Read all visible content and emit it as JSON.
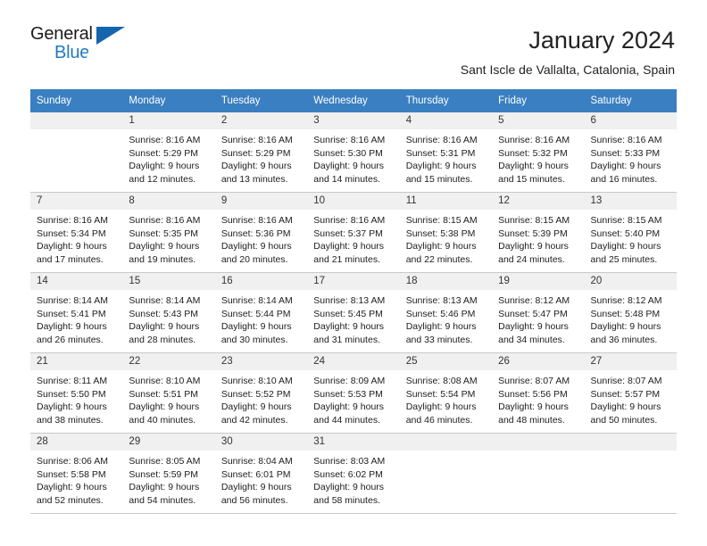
{
  "brand": {
    "name_top": "General",
    "name_bottom": "Blue",
    "accent_color": "#1f7ac4",
    "triangle_color": "#1565ac"
  },
  "header": {
    "title": "January 2024",
    "subtitle": "Sant Iscle de Vallalta, Catalonia, Spain"
  },
  "calendar": {
    "header_bg": "#3a7fc1",
    "daynum_bg": "#f0f0f0",
    "grid_line": "#c8c8c8",
    "weekdays": [
      "Sunday",
      "Monday",
      "Tuesday",
      "Wednesday",
      "Thursday",
      "Friday",
      "Saturday"
    ],
    "weeks": [
      [
        {
          "day": "",
          "sunrise": "",
          "sunset": "",
          "daylight_1": "",
          "daylight_2": ""
        },
        {
          "day": "1",
          "sunrise": "Sunrise: 8:16 AM",
          "sunset": "Sunset: 5:29 PM",
          "daylight_1": "Daylight: 9 hours",
          "daylight_2": "and 12 minutes."
        },
        {
          "day": "2",
          "sunrise": "Sunrise: 8:16 AM",
          "sunset": "Sunset: 5:29 PM",
          "daylight_1": "Daylight: 9 hours",
          "daylight_2": "and 13 minutes."
        },
        {
          "day": "3",
          "sunrise": "Sunrise: 8:16 AM",
          "sunset": "Sunset: 5:30 PM",
          "daylight_1": "Daylight: 9 hours",
          "daylight_2": "and 14 minutes."
        },
        {
          "day": "4",
          "sunrise": "Sunrise: 8:16 AM",
          "sunset": "Sunset: 5:31 PM",
          "daylight_1": "Daylight: 9 hours",
          "daylight_2": "and 15 minutes."
        },
        {
          "day": "5",
          "sunrise": "Sunrise: 8:16 AM",
          "sunset": "Sunset: 5:32 PM",
          "daylight_1": "Daylight: 9 hours",
          "daylight_2": "and 15 minutes."
        },
        {
          "day": "6",
          "sunrise": "Sunrise: 8:16 AM",
          "sunset": "Sunset: 5:33 PM",
          "daylight_1": "Daylight: 9 hours",
          "daylight_2": "and 16 minutes."
        }
      ],
      [
        {
          "day": "7",
          "sunrise": "Sunrise: 8:16 AM",
          "sunset": "Sunset: 5:34 PM",
          "daylight_1": "Daylight: 9 hours",
          "daylight_2": "and 17 minutes."
        },
        {
          "day": "8",
          "sunrise": "Sunrise: 8:16 AM",
          "sunset": "Sunset: 5:35 PM",
          "daylight_1": "Daylight: 9 hours",
          "daylight_2": "and 19 minutes."
        },
        {
          "day": "9",
          "sunrise": "Sunrise: 8:16 AM",
          "sunset": "Sunset: 5:36 PM",
          "daylight_1": "Daylight: 9 hours",
          "daylight_2": "and 20 minutes."
        },
        {
          "day": "10",
          "sunrise": "Sunrise: 8:16 AM",
          "sunset": "Sunset: 5:37 PM",
          "daylight_1": "Daylight: 9 hours",
          "daylight_2": "and 21 minutes."
        },
        {
          "day": "11",
          "sunrise": "Sunrise: 8:15 AM",
          "sunset": "Sunset: 5:38 PM",
          "daylight_1": "Daylight: 9 hours",
          "daylight_2": "and 22 minutes."
        },
        {
          "day": "12",
          "sunrise": "Sunrise: 8:15 AM",
          "sunset": "Sunset: 5:39 PM",
          "daylight_1": "Daylight: 9 hours",
          "daylight_2": "and 24 minutes."
        },
        {
          "day": "13",
          "sunrise": "Sunrise: 8:15 AM",
          "sunset": "Sunset: 5:40 PM",
          "daylight_1": "Daylight: 9 hours",
          "daylight_2": "and 25 minutes."
        }
      ],
      [
        {
          "day": "14",
          "sunrise": "Sunrise: 8:14 AM",
          "sunset": "Sunset: 5:41 PM",
          "daylight_1": "Daylight: 9 hours",
          "daylight_2": "and 26 minutes."
        },
        {
          "day": "15",
          "sunrise": "Sunrise: 8:14 AM",
          "sunset": "Sunset: 5:43 PM",
          "daylight_1": "Daylight: 9 hours",
          "daylight_2": "and 28 minutes."
        },
        {
          "day": "16",
          "sunrise": "Sunrise: 8:14 AM",
          "sunset": "Sunset: 5:44 PM",
          "daylight_1": "Daylight: 9 hours",
          "daylight_2": "and 30 minutes."
        },
        {
          "day": "17",
          "sunrise": "Sunrise: 8:13 AM",
          "sunset": "Sunset: 5:45 PM",
          "daylight_1": "Daylight: 9 hours",
          "daylight_2": "and 31 minutes."
        },
        {
          "day": "18",
          "sunrise": "Sunrise: 8:13 AM",
          "sunset": "Sunset: 5:46 PM",
          "daylight_1": "Daylight: 9 hours",
          "daylight_2": "and 33 minutes."
        },
        {
          "day": "19",
          "sunrise": "Sunrise: 8:12 AM",
          "sunset": "Sunset: 5:47 PM",
          "daylight_1": "Daylight: 9 hours",
          "daylight_2": "and 34 minutes."
        },
        {
          "day": "20",
          "sunrise": "Sunrise: 8:12 AM",
          "sunset": "Sunset: 5:48 PM",
          "daylight_1": "Daylight: 9 hours",
          "daylight_2": "and 36 minutes."
        }
      ],
      [
        {
          "day": "21",
          "sunrise": "Sunrise: 8:11 AM",
          "sunset": "Sunset: 5:50 PM",
          "daylight_1": "Daylight: 9 hours",
          "daylight_2": "and 38 minutes."
        },
        {
          "day": "22",
          "sunrise": "Sunrise: 8:10 AM",
          "sunset": "Sunset: 5:51 PM",
          "daylight_1": "Daylight: 9 hours",
          "daylight_2": "and 40 minutes."
        },
        {
          "day": "23",
          "sunrise": "Sunrise: 8:10 AM",
          "sunset": "Sunset: 5:52 PM",
          "daylight_1": "Daylight: 9 hours",
          "daylight_2": "and 42 minutes."
        },
        {
          "day": "24",
          "sunrise": "Sunrise: 8:09 AM",
          "sunset": "Sunset: 5:53 PM",
          "daylight_1": "Daylight: 9 hours",
          "daylight_2": "and 44 minutes."
        },
        {
          "day": "25",
          "sunrise": "Sunrise: 8:08 AM",
          "sunset": "Sunset: 5:54 PM",
          "daylight_1": "Daylight: 9 hours",
          "daylight_2": "and 46 minutes."
        },
        {
          "day": "26",
          "sunrise": "Sunrise: 8:07 AM",
          "sunset": "Sunset: 5:56 PM",
          "daylight_1": "Daylight: 9 hours",
          "daylight_2": "and 48 minutes."
        },
        {
          "day": "27",
          "sunrise": "Sunrise: 8:07 AM",
          "sunset": "Sunset: 5:57 PM",
          "daylight_1": "Daylight: 9 hours",
          "daylight_2": "and 50 minutes."
        }
      ],
      [
        {
          "day": "28",
          "sunrise": "Sunrise: 8:06 AM",
          "sunset": "Sunset: 5:58 PM",
          "daylight_1": "Daylight: 9 hours",
          "daylight_2": "and 52 minutes."
        },
        {
          "day": "29",
          "sunrise": "Sunrise: 8:05 AM",
          "sunset": "Sunset: 5:59 PM",
          "daylight_1": "Daylight: 9 hours",
          "daylight_2": "and 54 minutes."
        },
        {
          "day": "30",
          "sunrise": "Sunrise: 8:04 AM",
          "sunset": "Sunset: 6:01 PM",
          "daylight_1": "Daylight: 9 hours",
          "daylight_2": "and 56 minutes."
        },
        {
          "day": "31",
          "sunrise": "Sunrise: 8:03 AM",
          "sunset": "Sunset: 6:02 PM",
          "daylight_1": "Daylight: 9 hours",
          "daylight_2": "and 58 minutes."
        },
        {
          "day": "",
          "sunrise": "",
          "sunset": "",
          "daylight_1": "",
          "daylight_2": ""
        },
        {
          "day": "",
          "sunrise": "",
          "sunset": "",
          "daylight_1": "",
          "daylight_2": ""
        },
        {
          "day": "",
          "sunrise": "",
          "sunset": "",
          "daylight_1": "",
          "daylight_2": ""
        }
      ]
    ]
  }
}
